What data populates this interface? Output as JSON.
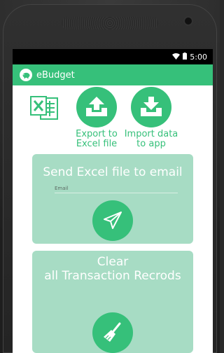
{
  "status_bar": {
    "time": "5:00"
  },
  "app": {
    "title": "eBudget"
  },
  "tools": [
    {
      "label_line1": "Export to",
      "label_line2": "Excel file",
      "icon": "upload-icon"
    },
    {
      "label_line1": "Import data",
      "label_line2": "to app",
      "icon": "download-icon"
    }
  ],
  "email_card": {
    "title": "Send Excel file to email",
    "email_label": "Email",
    "icon": "paper-plane-icon"
  },
  "clear_card": {
    "title_line1": "Clear",
    "title_line2": "all Transaction Recrods",
    "icon": "broom-icon"
  },
  "colors": {
    "accent": "#36c07a",
    "card": "#a7dcc4",
    "statusbar": "#000000"
  }
}
